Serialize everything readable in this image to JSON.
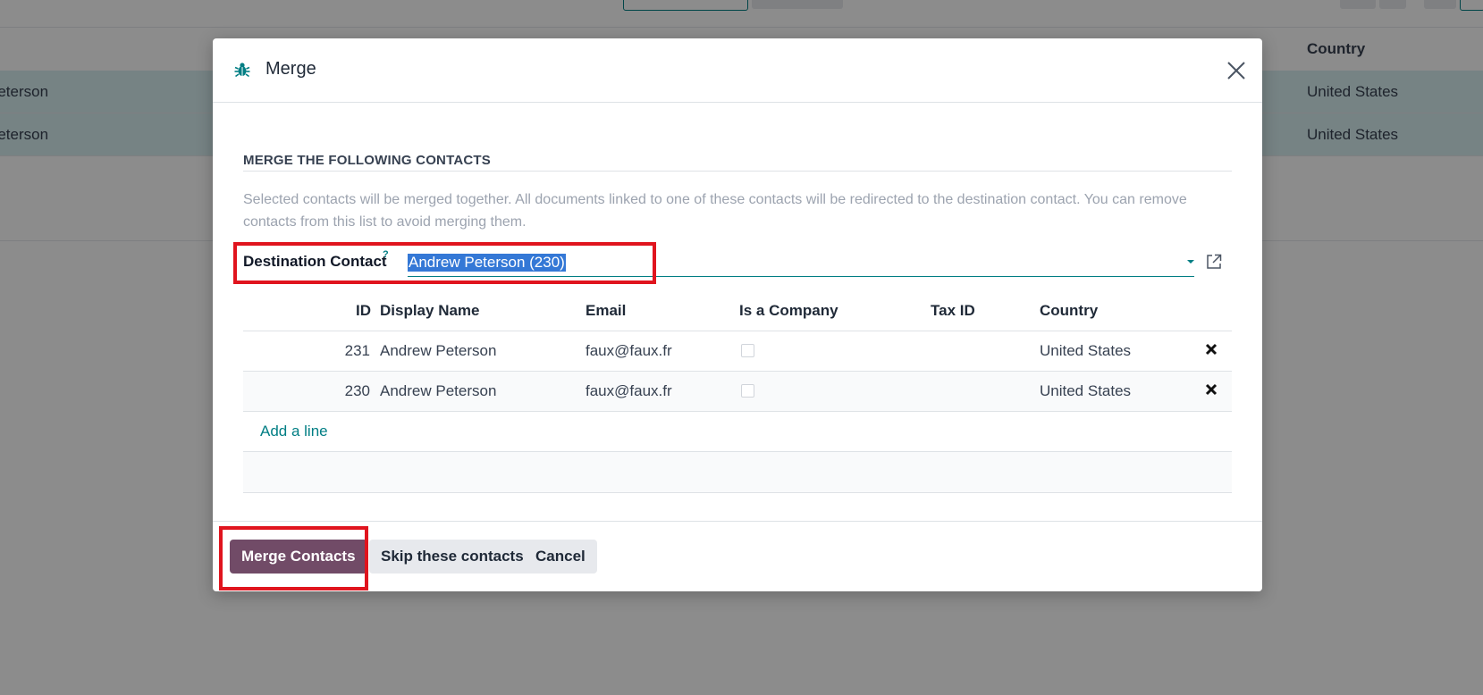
{
  "background": {
    "header_country": "Country",
    "rows": [
      {
        "name": "Peterson",
        "country": "United States"
      },
      {
        "name": "Peterson",
        "country": "United States"
      }
    ]
  },
  "dialog": {
    "title": "Merge",
    "section_title": "MERGE THE FOLLOWING CONTACTS",
    "help_text": "Selected contacts will be merged together. All documents linked to one of these contacts will be redirected to the destination contact. You can remove contacts from this list to avoid merging them.",
    "destination": {
      "label": "Destination Contact",
      "help_mark": "?",
      "value": "Andrew Peterson (230)"
    },
    "table": {
      "columns": [
        "ID",
        "Display Name",
        "Email",
        "Is a Company",
        "Tax ID",
        "Country"
      ],
      "rows": [
        {
          "id": "231",
          "name": "Andrew Peterson",
          "email": "faux@faux.fr",
          "is_company": false,
          "tax_id": "",
          "country": "United States"
        },
        {
          "id": "230",
          "name": "Andrew Peterson",
          "email": "faux@faux.fr",
          "is_company": false,
          "tax_id": "",
          "country": "United States"
        }
      ],
      "add_line": "Add a line"
    },
    "buttons": {
      "merge": "Merge Contacts",
      "skip": "Skip these contacts",
      "cancel": "Cancel"
    }
  },
  "colors": {
    "primary": "#714b67",
    "accent": "#017e84",
    "highlight": "#e0141e",
    "selection": "#3478d6"
  }
}
